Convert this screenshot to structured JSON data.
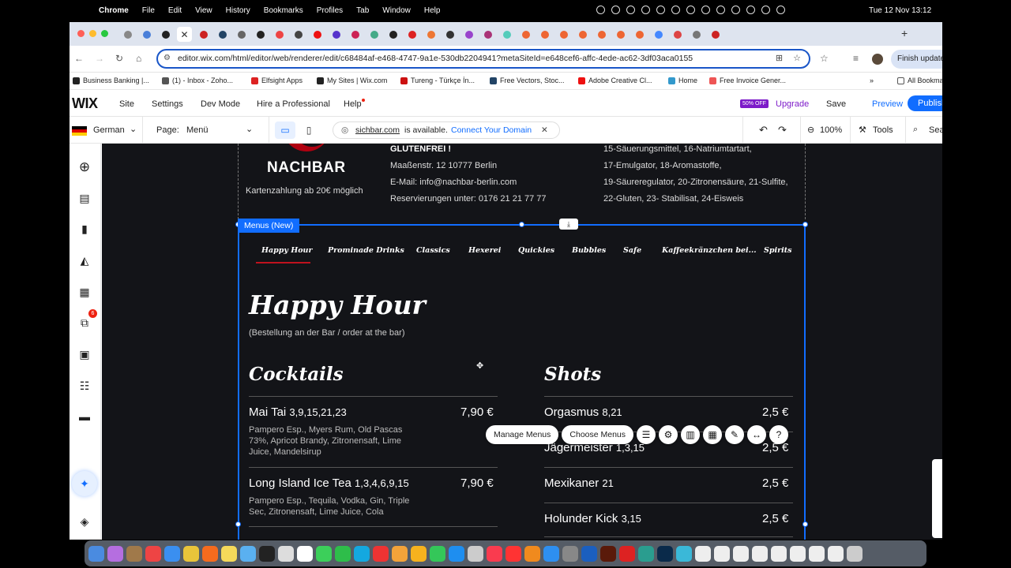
{
  "macos": {
    "app": "Chrome",
    "menu": [
      "File",
      "Edit",
      "View",
      "History",
      "Bookmarks",
      "Profiles",
      "Tab",
      "Window",
      "Help"
    ],
    "clock": "Tue 12 Nov  13:12"
  },
  "browser": {
    "url": "editor.wix.com/html/editor/web/renderer/edit/c68484af-e468-4747-9a1e-530db2204941?metaSiteId=e648cef6-affc-4ede-ac62-3df03aca0155",
    "finish_update": "Finish update",
    "bookmarks": [
      "Business Banking |...",
      "(1) - Inbox - Zoho...",
      "Elfsight Apps",
      "My Sites | Wix.com",
      "Tureng - Türkçe İn...",
      "Free Vectors, Stoc...",
      "Adobe Creative Cl...",
      "Home",
      "Free Invoice Gener..."
    ],
    "all_bookmarks": "All Bookmarks"
  },
  "wix": {
    "logo": "WIX",
    "nav": [
      "Site",
      "Settings",
      "Dev Mode",
      "Hire a Professional",
      "Help"
    ],
    "off_badge": "50% OFF",
    "upgrade": "Upgrade",
    "save": "Save",
    "preview": "Preview",
    "publish": "Publish",
    "language": "German",
    "page_label": "Page:",
    "page_value": "Menü",
    "domain_name": "sichbar.com",
    "domain_text": "is available.",
    "connect": "Connect Your Domain",
    "zoom": "100%",
    "tools": "Tools",
    "search": "Search",
    "sidebar_badge": "6"
  },
  "site": {
    "brand": "NACHBAR",
    "card_note": "Kartenzahlung ab 20€ möglich",
    "glutenfree": "GLUTENFREI !",
    "address": "Maaßenstr. 12 10777 Berlin",
    "email": "E-Mail: info@nachbar-berlin.com",
    "reserve": "Reservierungen unter: 0176 21 21 77 77",
    "additives": [
      "15-Säuerungsmittel, 16-Natriumtartart,",
      "17-Emulgator, 18-Aromastoffe,",
      "19-Säureregulator, 20-Zitronensäure, 21-Sulfite,",
      "22-Gluten, 23- Stabilisat, 24-Eisweis"
    ]
  },
  "menus_tag": "Menus (New)",
  "menu_tabs": [
    "Happy Hour",
    "Prominade Drinks",
    "Classics",
    "Hexerei",
    "Quickies",
    "Bubbles",
    "Safe",
    "Kaffeekränzchen bei...",
    "Spirits"
  ],
  "menu": {
    "title": "Happy Hour",
    "subtitle": "(Bestellung an der Bar / order at the bar)",
    "cocktails": {
      "title": "Cocktails",
      "items": [
        {
          "name": "Mai Tai",
          "codes": "3,9,15,21,23",
          "price": "7,90 €",
          "desc": "Pampero Esp., Myers Rum, Old Pascas 73%, Apricot Brandy, Zitronensaft, Lime Juice, Mandelsirup"
        },
        {
          "name": "Long Island Ice Tea",
          "codes": "1,3,4,6,9,15",
          "price": "7,90 €",
          "desc": "Pampero Esp., Tequila, Vodka, Gin, Triple Sec, Zitronensaft, Lime Juice, Cola"
        }
      ]
    },
    "shots": {
      "title": "Shots",
      "items": [
        {
          "name": "Orgasmus",
          "codes": "8,21",
          "price": "2,5 €"
        },
        {
          "name": "Jägermeister",
          "codes": "1,3,15",
          "price": "2,5 €"
        },
        {
          "name": "Mexikaner",
          "codes": "21",
          "price": "2,5 €"
        },
        {
          "name": "Holunder Kick",
          "codes": "3,15",
          "price": "2,5 €"
        }
      ]
    }
  },
  "gfpp": {
    "manage": "Manage Menus",
    "choose": "Choose Menus"
  },
  "colors": {
    "accent": "#116dff",
    "brand_red": "#c0121e",
    "canvas_bg": "#131418",
    "upgrade": "#7d1bc9"
  }
}
